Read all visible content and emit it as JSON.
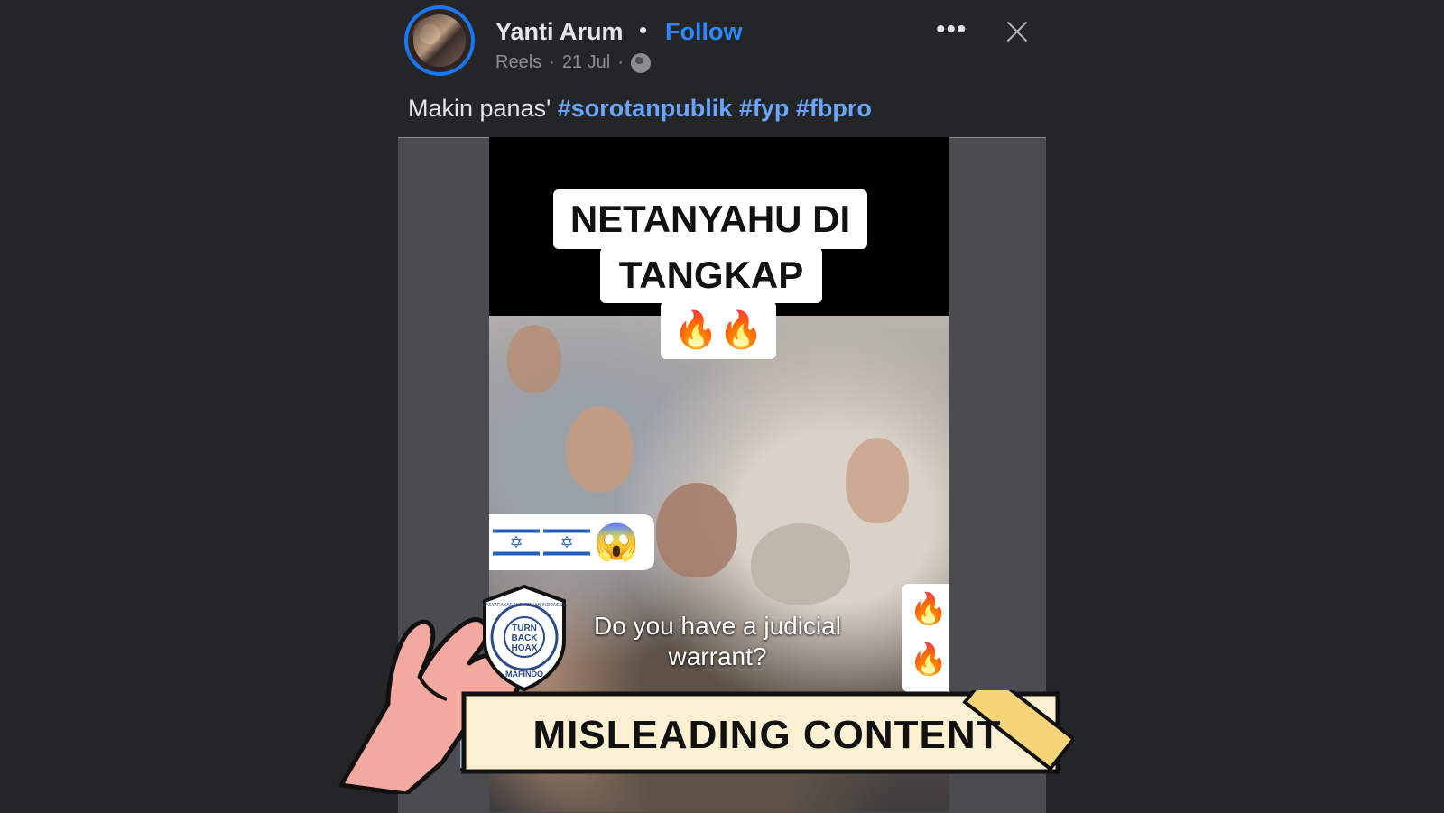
{
  "post": {
    "author_name": "Yanti Arum",
    "separator": "•",
    "follow_label": "Follow",
    "source": "Reels",
    "date": "21 Jul",
    "audience_icon": "globe-icon",
    "more_icon": "more-options-icon",
    "more_label": "•••",
    "close_icon": "close-icon",
    "caption_text": "Makin panas'",
    "hashtags": [
      "#sorotanpublik",
      "#fyp",
      "#fbpro"
    ]
  },
  "video": {
    "headline_line1": "NETANYAHU DI",
    "headline_line2": "TANGKAP",
    "headline_emoji": "🔥🔥",
    "flags_emoji": "😱",
    "flag_symbol": "✡",
    "side_emoji_1": "🔥",
    "side_emoji_2": "🔥",
    "subtitle": "Do you have a judicial warrant?"
  },
  "overlay": {
    "stamp_label": "MISLEADING CONTENT",
    "seal_top_text": "MASYARAKAT ANTI FITNAH INDONESIA",
    "seal_center_text": [
      "TURN",
      "BACK",
      "HOAX"
    ],
    "seal_bottom_text": "MAFINDO"
  },
  "colors": {
    "background": "#242526",
    "follow_blue": "#2d88ff",
    "hashtag_blue": "#6aa6ff",
    "banner_fill": "#fbf1d2",
    "tape_yellow": "#f6d478",
    "hand_pink": "#f3a9a0",
    "seal_navy": "#2b4a8a"
  }
}
